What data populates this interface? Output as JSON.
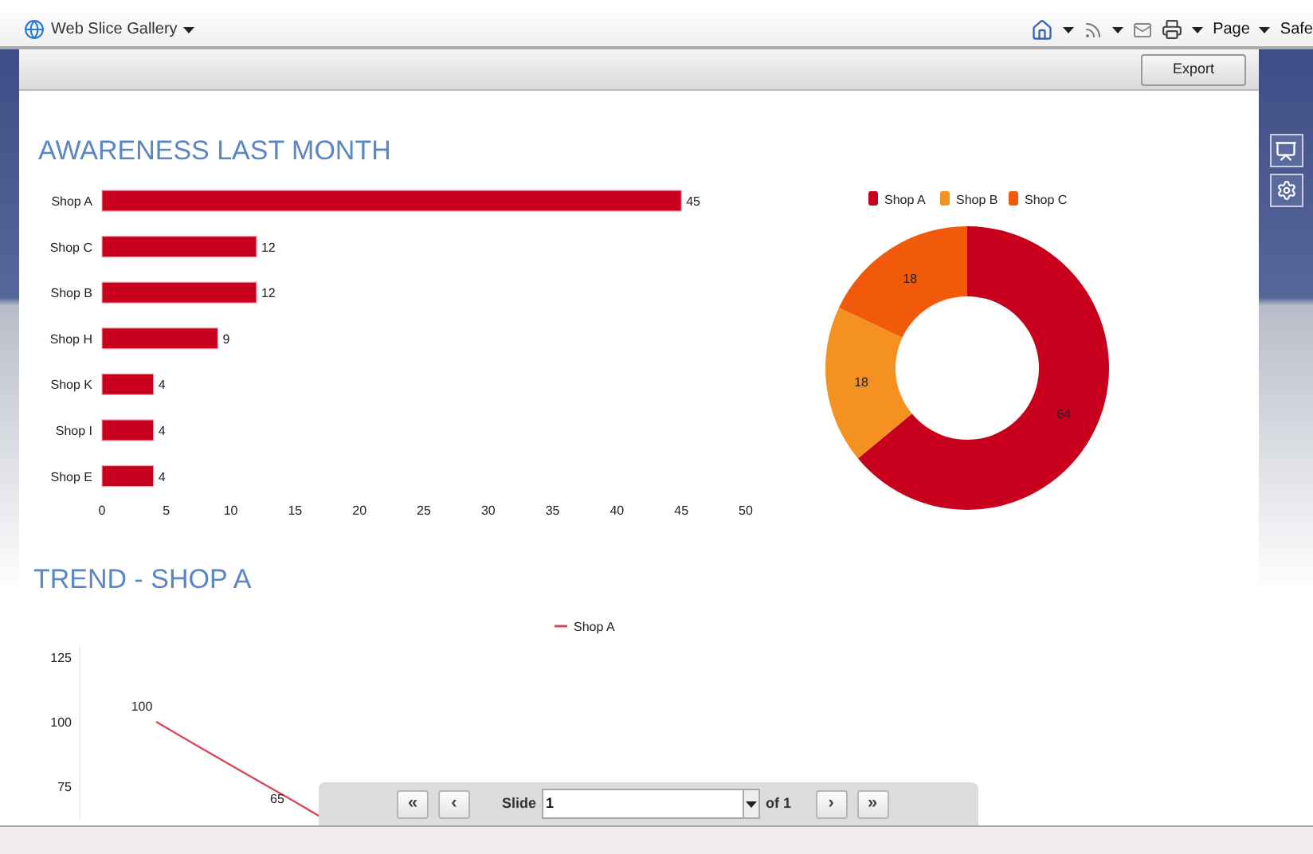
{
  "browser_toolbar": {
    "web_slice_gallery": "Web Slice Gallery",
    "page_menu": "Page",
    "safety_menu": "Safe"
  },
  "export_button": "Export",
  "awareness": {
    "title": "AWARENESS LAST MONTH",
    "chart_data": {
      "type": "bar",
      "orientation": "horizontal",
      "categories": [
        "Shop A",
        "Shop C",
        "Shop B",
        "Shop H",
        "Shop K",
        "Shop I",
        "Shop E"
      ],
      "values": [
        45,
        12,
        12,
        9,
        4,
        4,
        4
      ],
      "xlim": [
        0,
        50
      ],
      "xticks": [
        0,
        5,
        10,
        15,
        20,
        25,
        30,
        35,
        40,
        45,
        50
      ],
      "data_labels": true
    }
  },
  "share": {
    "chart_data": {
      "type": "donut",
      "categories": [
        "Shop A",
        "Shop B",
        "Shop C"
      ],
      "values": [
        64,
        18,
        18
      ],
      "data_labels": true,
      "legend": "top"
    }
  },
  "trend": {
    "title": "TREND - SHOP A",
    "legend_label": "Shop A",
    "y_axis_labels": [
      "125",
      "100",
      "75"
    ],
    "point_labels": [
      "100",
      "65"
    ]
  },
  "pager": {
    "first": "«",
    "previous": "‹",
    "slide_label": "Slide",
    "slide_value": "1",
    "of_label": "of 1",
    "next": "›",
    "last": "»"
  }
}
